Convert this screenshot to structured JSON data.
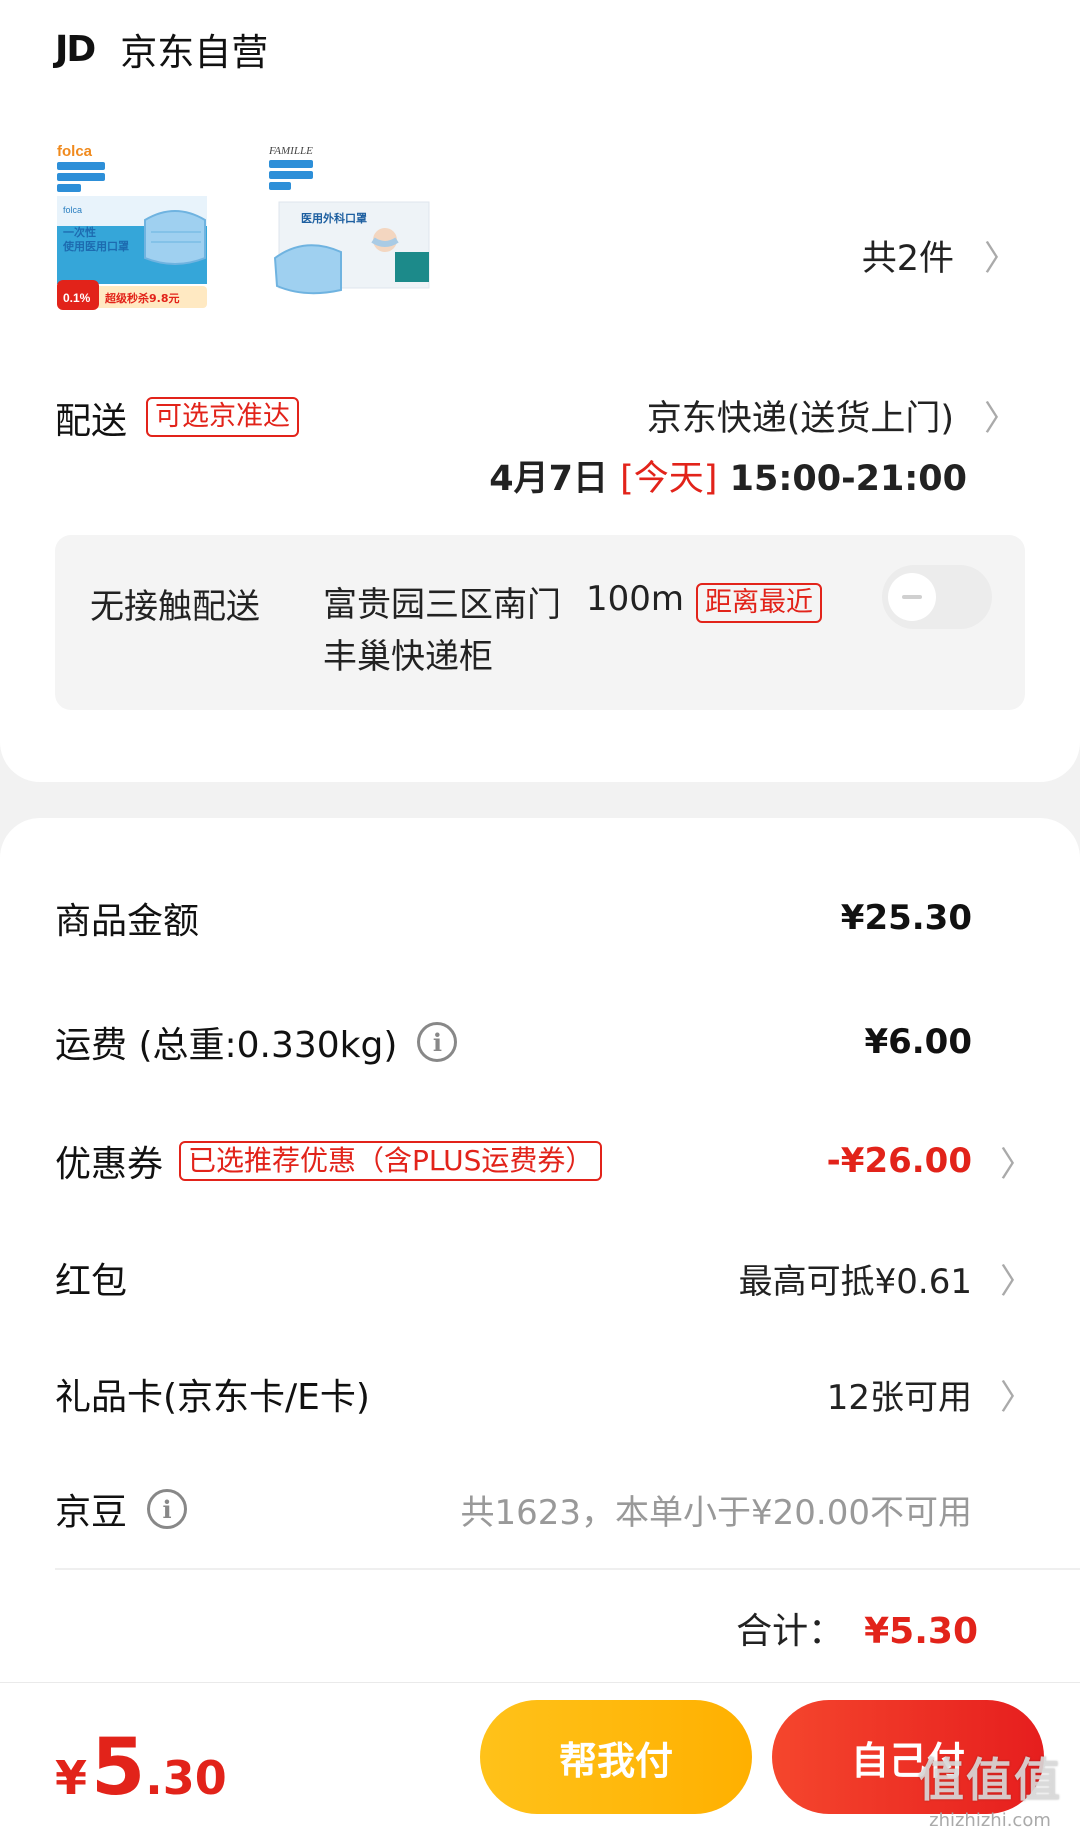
{
  "shop": {
    "logo": "JD",
    "name": "京东自营"
  },
  "products": {
    "count_label": "共2件",
    "items": [
      {
        "name": "folca",
        "badge": "超级秒杀9.8元",
        "discount": "0.1%"
      },
      {
        "name": "FAMILLE",
        "badge": "医用外科口罩"
      }
    ]
  },
  "delivery": {
    "label": "配送",
    "tag": "可选京准达",
    "method": "京东快递(送货上门)",
    "date": "4月7日",
    "today": "[今天]",
    "time": "15:00-21:00"
  },
  "contactless": {
    "label": "无接触配送",
    "address": "富贵园三区南门丰巢快递柜",
    "distance": "100m",
    "tag": "距离最近",
    "enabled": false
  },
  "price": {
    "goods_label": "商品金额",
    "goods_value": "¥25.30",
    "shipping_label": "运费 (总重:0.330kg)",
    "shipping_value": "¥6.00",
    "coupon_label": "优惠券",
    "coupon_tag": "已选推荐优惠（含PLUS运费券）",
    "coupon_value": "-¥26.00",
    "redpacket_label": "红包",
    "redpacket_value": "最高可抵¥0.61",
    "giftcard_label": "礼品卡(京东卡/E卡)",
    "giftcard_value": "12张可用",
    "jingdou_label": "京豆",
    "jingdou_value": "共1623，本单小于¥20.00不可用",
    "total_label": "合计：",
    "total_value": "¥5.30"
  },
  "checkout": {
    "currency": "¥",
    "amount_int": "5",
    "amount_dec": ".30",
    "help_pay": "帮我付",
    "self_pay": "自己付"
  },
  "watermark": {
    "big": "值值值",
    "small": "zhizhizhi.com"
  },
  "colors": {
    "accent": "#e2231a",
    "help_btn": "#ffb800",
    "self_btn": "#ee2b22"
  }
}
